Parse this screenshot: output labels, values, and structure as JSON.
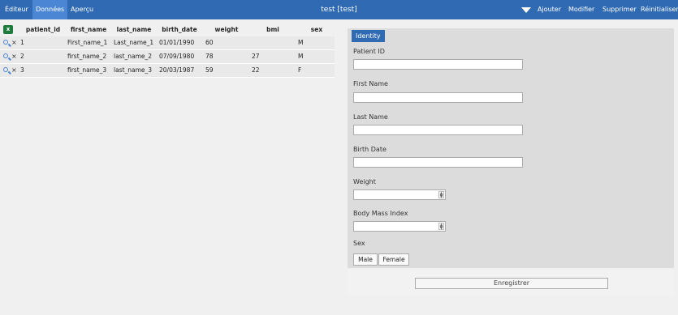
{
  "header": {
    "tabs": [
      {
        "label": "Éditeur",
        "active": false
      },
      {
        "label": "Données",
        "active": true
      },
      {
        "label": "Aperçu",
        "active": false
      }
    ],
    "title": "test [test]",
    "actions": [
      "Ajouter",
      "Modifier",
      "Supprimer",
      "Réinitialiser"
    ],
    "color": "#2f6ab3"
  },
  "table": {
    "columns": [
      "patient_id",
      "first_name",
      "last_name",
      "birth_date",
      "weight",
      "bmi",
      "sex"
    ],
    "rows": [
      [
        "1",
        "First_name_1",
        "Last_name_1",
        "01/01/1990",
        "60",
        "",
        "M"
      ],
      [
        "2",
        "first_name_2",
        "last_name_2",
        "07/09/1980",
        "78",
        "27",
        "M"
      ],
      [
        "3",
        "first_name_3",
        "last_name_3",
        "20/03/1987",
        "59",
        "22",
        "F"
      ]
    ]
  },
  "form": {
    "legend": "Identity",
    "fields": {
      "patient_id": {
        "label": "Patient ID",
        "value": ""
      },
      "first_name": {
        "label": "First Name",
        "value": ""
      },
      "last_name": {
        "label": "Last Name",
        "value": ""
      },
      "birth_date": {
        "label": "Birth Date",
        "value": ""
      },
      "weight": {
        "label": "Weight",
        "value": ""
      },
      "bmi": {
        "label": "Body Mass Index",
        "value": ""
      },
      "sex": {
        "label": "Sex",
        "options": [
          "Male",
          "Female"
        ]
      }
    },
    "save_label": "Enregistrer"
  }
}
